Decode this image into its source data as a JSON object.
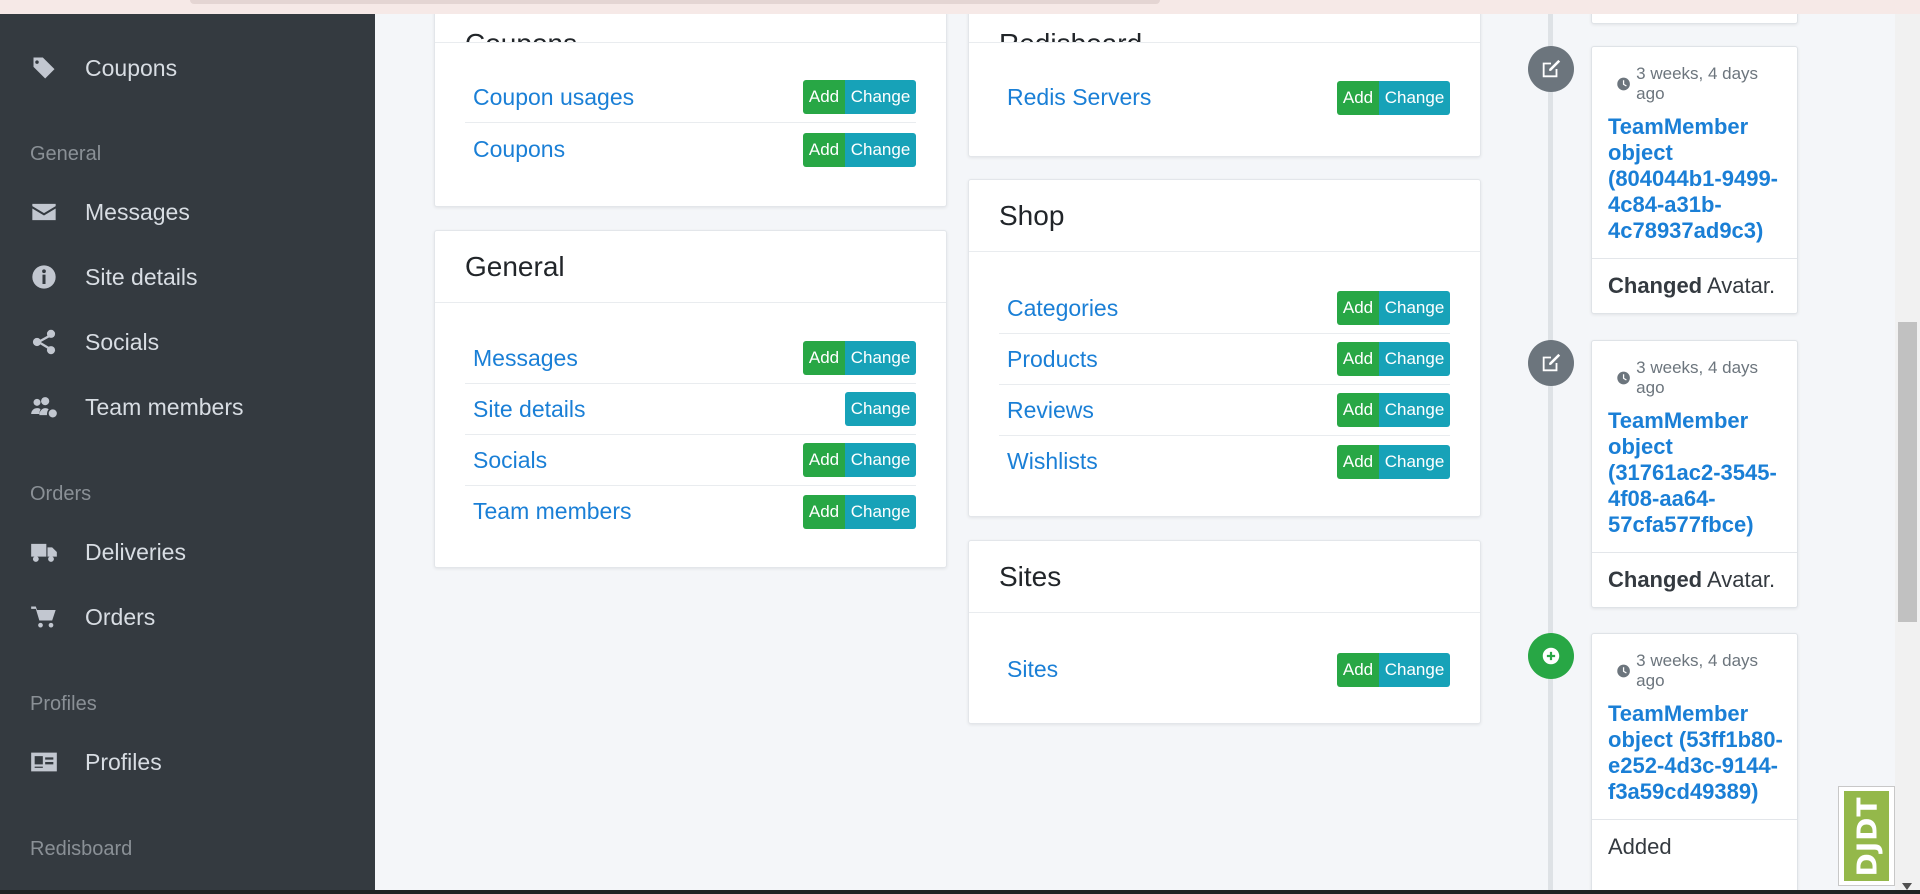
{
  "sidebar": {
    "items": [
      {
        "label": "Coupons",
        "icon": "tags-icon"
      },
      {
        "label": "Messages",
        "icon": "envelope-icon"
      },
      {
        "label": "Site details",
        "icon": "info-circle-icon"
      },
      {
        "label": "Socials",
        "icon": "share-icon"
      },
      {
        "label": "Team members",
        "icon": "users-cog-icon"
      },
      {
        "label": "Deliveries",
        "icon": "truck-icon"
      },
      {
        "label": "Orders",
        "icon": "shopping-cart-icon"
      },
      {
        "label": "Profiles",
        "icon": "id-card-icon"
      }
    ],
    "headers": [
      "General",
      "Orders",
      "Profiles",
      "Redisboard"
    ]
  },
  "cards": {
    "coupons": {
      "title": "Coupons",
      "rows": [
        {
          "label": "Coupon usages",
          "add": "Add",
          "change": "Change"
        },
        {
          "label": "Coupons",
          "add": "Add",
          "change": "Change"
        }
      ]
    },
    "general": {
      "title": "General",
      "rows": [
        {
          "label": "Messages",
          "add": "Add",
          "change": "Change"
        },
        {
          "label": "Site details",
          "change": "Change"
        },
        {
          "label": "Socials",
          "add": "Add",
          "change": "Change"
        },
        {
          "label": "Team members",
          "add": "Add",
          "change": "Change"
        }
      ]
    },
    "redisboard": {
      "title": "Redisboard",
      "rows": [
        {
          "label": "Redis Servers",
          "add": "Add",
          "change": "Change"
        }
      ]
    },
    "shop": {
      "title": "Shop",
      "rows": [
        {
          "label": "Categories",
          "add": "Add",
          "change": "Change"
        },
        {
          "label": "Products",
          "add": "Add",
          "change": "Change"
        },
        {
          "label": "Reviews",
          "add": "Add",
          "change": "Change"
        },
        {
          "label": "Wishlists",
          "add": "Add",
          "change": "Change"
        }
      ]
    },
    "sites": {
      "title": "Sites",
      "rows": [
        {
          "label": "Sites",
          "add": "Add",
          "change": "Change"
        }
      ]
    }
  },
  "timeline": [
    {
      "time": "3 weeks, 4 days ago",
      "title": "TeamMember object (804044b1-9499-4c84-a31b-4c78937ad9c3)",
      "action": "Changed",
      "detail": "Avatar.",
      "icon": "edit-icon",
      "color": "#6c757d"
    },
    {
      "time": "3 weeks, 4 days ago",
      "title": "TeamMember object (31761ac2-3545-4f08-aa64-57cfa577fbce)",
      "action": "Changed",
      "detail": "Avatar.",
      "icon": "edit-icon",
      "color": "#6c757d"
    },
    {
      "time": "3 weeks, 4 days ago",
      "title": "TeamMember object (53ff1b80-e252-4d3c-9144-f3a59cd49389)",
      "action": "Added",
      "detail": "",
      "icon": "plus-circle-icon",
      "color": "#28a745"
    }
  ],
  "djdt": {
    "label": "DJDT"
  },
  "colors": {
    "sidebar": "#343a40",
    "add": "#28a745",
    "change": "#17a2b8",
    "link": "#1a7fd6"
  }
}
